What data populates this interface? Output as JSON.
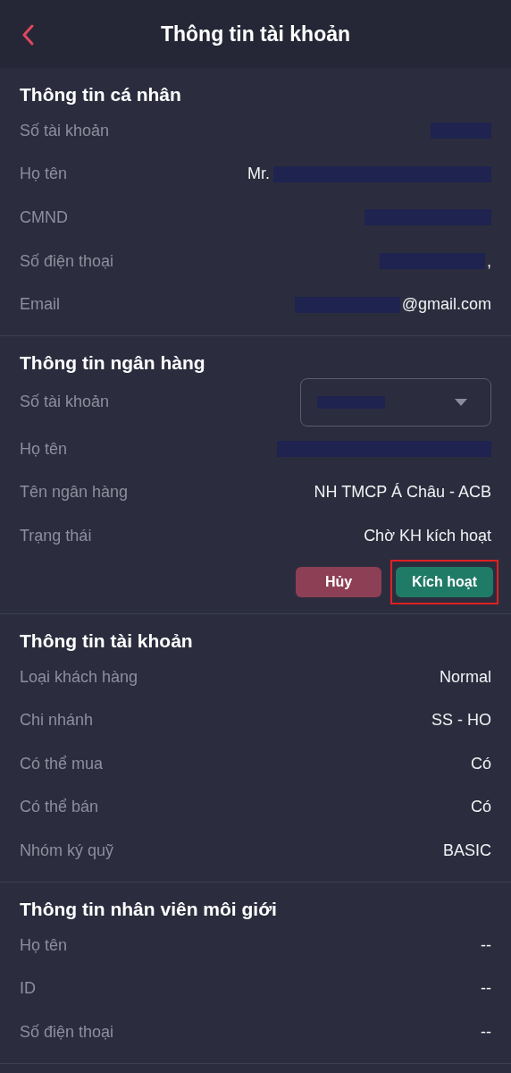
{
  "header": {
    "title": "Thông tin tài khoản"
  },
  "sections": [
    {
      "title": "Thông tin cá nhân",
      "rows": [
        {
          "label": "Số tài khoản",
          "kind": "redacted"
        },
        {
          "label": "Họ tên",
          "kind": "text_then_redacted",
          "value": "Mr."
        },
        {
          "label": "CMND",
          "kind": "redacted"
        },
        {
          "label": "Số điện thoại",
          "kind": "redacted_then_text",
          "value": ","
        },
        {
          "label": "Email",
          "kind": "redacted_then_text",
          "value": "@gmail.com"
        }
      ]
    },
    {
      "title": "Thông tin ngân hàng",
      "rows": [
        {
          "label": "Số tài khoản",
          "kind": "select"
        },
        {
          "label": "Họ tên",
          "kind": "redacted"
        },
        {
          "label": "Tên ngân hàng",
          "kind": "text",
          "value": "NH TMCP Á Châu - ACB"
        },
        {
          "label": "Trạng thái",
          "kind": "text",
          "value": "Chờ KH kích hoạt"
        }
      ],
      "actions": [
        {
          "label": "Hủy",
          "kind": "cancel",
          "highlighted": false
        },
        {
          "label": "Kích hoạt",
          "kind": "confirm",
          "highlighted": true
        }
      ]
    },
    {
      "title": "Thông tin tài khoản",
      "rows": [
        {
          "label": "Loại khách hàng",
          "kind": "text",
          "value": "Normal"
        },
        {
          "label": "Chi nhánh",
          "kind": "text",
          "value": "SS - HO"
        },
        {
          "label": "Có thể mua",
          "kind": "text",
          "value": "Có"
        },
        {
          "label": "Có thể bán",
          "kind": "text",
          "value": "Có"
        },
        {
          "label": "Nhóm ký quỹ",
          "kind": "text",
          "value": "BASIC"
        }
      ]
    },
    {
      "title": "Thông tin nhân viên môi giới",
      "rows": [
        {
          "label": "Họ tên",
          "kind": "text",
          "value": "--"
        },
        {
          "label": "ID",
          "kind": "text",
          "value": "--"
        },
        {
          "label": "Số điện thoại",
          "kind": "text",
          "value": "--"
        }
      ]
    }
  ]
}
